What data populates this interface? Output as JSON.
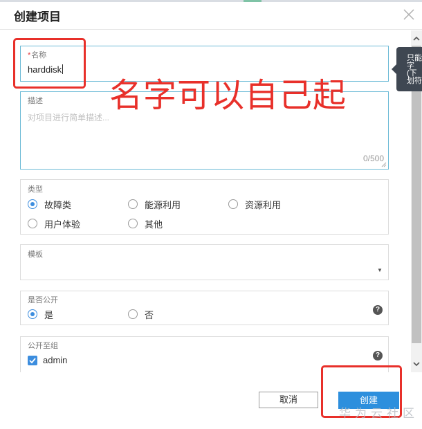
{
  "dialog": {
    "title": "创建项目"
  },
  "name_field": {
    "label": "名称",
    "required_mark": "*",
    "value": "harddisk"
  },
  "description_field": {
    "label": "描述",
    "placeholder": "对项目进行简单描述...",
    "counter": "0/500"
  },
  "type_field": {
    "label": "类型",
    "options": [
      {
        "label": "故障类",
        "selected": true
      },
      {
        "label": "能源利用",
        "selected": false
      },
      {
        "label": "资源利用",
        "selected": false
      },
      {
        "label": "用户体验",
        "selected": false
      },
      {
        "label": "其他",
        "selected": false
      }
    ]
  },
  "template_field": {
    "label": "模板",
    "value": ""
  },
  "public_field": {
    "label": "是否公开",
    "options": [
      {
        "label": "是",
        "selected": true
      },
      {
        "label": "否",
        "selected": false
      }
    ]
  },
  "public_group_field": {
    "label": "公开至组",
    "options": [
      {
        "label": "admin",
        "checked": true
      }
    ]
  },
  "tooltip": {
    "text": "只能字(下划符"
  },
  "buttons": {
    "cancel": "取消",
    "create": "创建"
  },
  "annotation": {
    "text": "名字可以自己起"
  },
  "watermark": {
    "text": "华为云社区"
  },
  "colors": {
    "accent": "#2d8fdd",
    "annotation_red": "#e8302a",
    "focus_border": "#6bbad6"
  }
}
